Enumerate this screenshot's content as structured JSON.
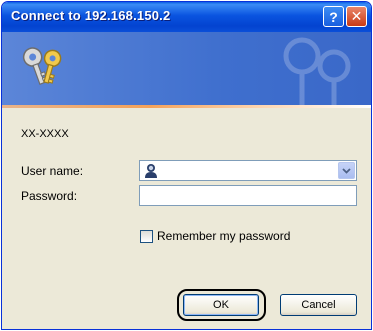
{
  "window": {
    "title": "Connect to 192.168.150.2",
    "help_label": "?",
    "close_label": "✕"
  },
  "banner": {
    "icon": "keys-icon",
    "watermark_icon": "keys-watermark-icon"
  },
  "form": {
    "server": "XX-XXXX",
    "user_label": "User name:",
    "user_value": "",
    "password_label": "Password:",
    "password_value": "",
    "remember_label": "Remember my password",
    "remember_checked": false
  },
  "buttons": {
    "ok": "OK",
    "cancel": "Cancel"
  },
  "colors": {
    "titlebar": "#0a54e0",
    "banner": "#4a78d2",
    "dialog_bg": "#ece9d8",
    "highlight": "#000000"
  }
}
